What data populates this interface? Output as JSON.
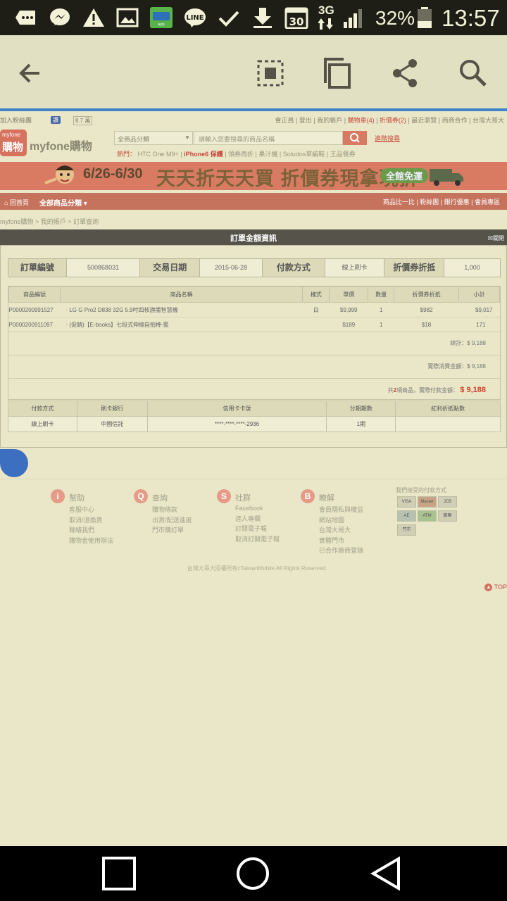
{
  "status_bar": {
    "network": "3G",
    "battery_percent": "32%",
    "time": "13:57",
    "icons": [
      "message-icon",
      "messenger-icon",
      "warning-icon",
      "image-icon",
      "app-icon",
      "line-icon",
      "check-icon",
      "download-icon",
      "calendar-icon",
      "signal-icon",
      "battery-icon"
    ],
    "calendar_day": "30"
  },
  "toolbar": {
    "icons": [
      "back-arrow-icon",
      "select-region-icon",
      "copy-icon",
      "share-icon",
      "search-icon"
    ]
  },
  "site": {
    "fb_join": "加入粉絲團",
    "fb_like": "讚",
    "fb_count": "8.7 萬",
    "top_links": [
      "會正員",
      "登出",
      "我的帳戶",
      "購物車(4)",
      "折價券(2)",
      "最近瀏覽",
      "商商合作",
      "台灣大哥大"
    ],
    "logo_small": "myfone",
    "logo_big": "購物",
    "logo_text": "myfone購物",
    "category_select": "全商品分類",
    "search_placeholder": "請輸入您要搜尋的商品名稱",
    "advanced_search": "進階搜尋",
    "hot_label": "熱門：",
    "hot_items": [
      "HTC One M9+",
      "iPhone6 保護",
      "領券再折",
      "果汁機",
      "Soludos草編鞋",
      "王品餐券"
    ],
    "banner": {
      "date": "6/26-6/30",
      "main": "天天折天天買 折價券現拿現折",
      "pill": "全館免運"
    },
    "nav_home": "回首頁",
    "nav_all": "全部商品分類",
    "nav_right": [
      "商品比一比",
      "粉絲團",
      "銀行優惠",
      "會員專區"
    ],
    "breadcrumb": [
      "myfone購物",
      "我的帳戶",
      "訂單查詢"
    ]
  },
  "order": {
    "title": "訂單金額資訊",
    "close": "關閉",
    "summary": {
      "order_no_label": "訂單編號",
      "order_no": "500868031",
      "date_label": "交易日期",
      "date": "2015-06-28",
      "pay_label": "付款方式",
      "pay": "線上刷卡",
      "coupon_label": "折價券折抵",
      "coupon": "1,000"
    },
    "item_headers": [
      "商品編號",
      "商品名稱",
      "樣式",
      "單價",
      "數量",
      "折價券折抵",
      "小計"
    ],
    "items": [
      {
        "code": "P0000200991527",
        "name": "· LG G Pro2 D838 32G 5.9吋四核旗艦智慧機",
        "style": "白",
        "price": "$9,999",
        "qty": "1",
        "coupon": "$982",
        "subtotal": "$9,017"
      },
      {
        "code": "P0000200911097",
        "name": "· (促銷)【E-books】七段式伸縮自拍棒-藍",
        "style": "",
        "price": "$189",
        "qty": "1",
        "coupon": "$18",
        "subtotal": "171"
      }
    ],
    "total_label": "總計：",
    "total": "$ 9,188",
    "actual_label": "實際消費金額：",
    "actual": "$ 9,188",
    "pay_prefix": "共",
    "pay_count": "2",
    "pay_suffix": "項商品，實際付款金額：",
    "pay_total": "$ 9,188",
    "pay_headers": [
      "付款方式",
      "刷卡銀行",
      "信用卡卡號",
      "分期期數",
      "紅利折抵點數"
    ],
    "pay_row": [
      "線上刷卡",
      "中國信託",
      "****-****-****-2936",
      "1期",
      ""
    ]
  },
  "footer": {
    "cols": [
      {
        "title": "幫助",
        "icon": "i",
        "items": [
          "客服中心",
          "取消/退換貨",
          "聯絡我們",
          "購物金使用辦法"
        ]
      },
      {
        "title": "查詢",
        "icon": "Q",
        "items": [
          "購物條款",
          "出貨/配送進度",
          "門市購訂單"
        ]
      },
      {
        "title": "社群",
        "icon": "S",
        "items": [
          "Facebook",
          "達人專欄",
          "訂閱電子報",
          "取消訂閱電子報"
        ]
      },
      {
        "title": "瞭解",
        "icon": "B",
        "items": [
          "會員隱私與權益",
          "網站地圖",
          "台灣大哥大",
          "實體門市",
          "已合作廠商登錄"
        ]
      }
    ],
    "pay_methods_title": "我們接受的付款方式",
    "cards": [
      "VISA",
      "Master",
      "JCB",
      "AE",
      "ATM",
      "銀聯",
      "門市"
    ],
    "copyright": "台灣大哥大版權所有cTaiwanMobile All Rights Reserved.",
    "top": "TOP"
  },
  "nav_keys": [
    "recents-square-icon",
    "home-circle-icon",
    "back-triangle-icon"
  ]
}
